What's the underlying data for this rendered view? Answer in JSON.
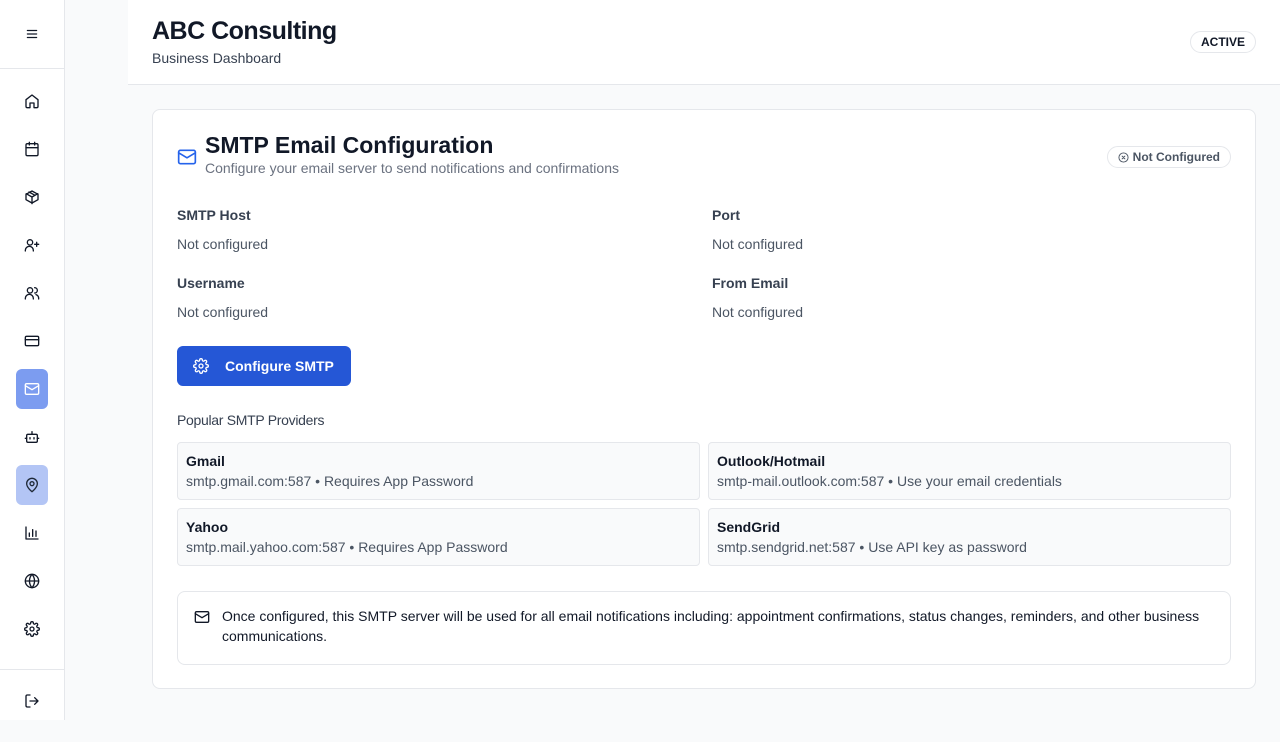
{
  "header": {
    "title": "ABC Consulting",
    "subtitle": "Business Dashboard",
    "status_badge": "ACTIVE"
  },
  "sidebar": {
    "items": [
      {
        "icon": "home-icon"
      },
      {
        "icon": "calendar-icon"
      },
      {
        "icon": "package-icon"
      },
      {
        "icon": "user-plus-icon"
      },
      {
        "icon": "users-icon"
      },
      {
        "icon": "credit-card-icon"
      },
      {
        "icon": "mail-icon",
        "active": true
      },
      {
        "icon": "bot-icon"
      },
      {
        "icon": "map-pin-icon",
        "highlighted": true
      },
      {
        "icon": "bar-chart-icon"
      },
      {
        "icon": "globe-icon"
      },
      {
        "icon": "settings-icon"
      }
    ],
    "logout_icon": "logout-icon",
    "menu_icon": "menu-icon"
  },
  "smtp": {
    "title": "SMTP Email Configuration",
    "subtitle": "Configure your email server to send notifications and confirmations",
    "status": "Not Configured",
    "fields": {
      "host_label": "SMTP Host",
      "host_value": "Not configured",
      "port_label": "Port",
      "port_value": "Not configured",
      "username_label": "Username",
      "username_value": "Not configured",
      "from_label": "From Email",
      "from_value": "Not configured"
    },
    "configure_button": "Configure SMTP",
    "providers_heading": "Popular SMTP Providers",
    "providers": [
      {
        "name": "Gmail",
        "detail": "smtp.gmail.com:587 • Requires App Password"
      },
      {
        "name": "Outlook/Hotmail",
        "detail": "smtp-mail.outlook.com:587 • Use your email credentials"
      },
      {
        "name": "Yahoo",
        "detail": "smtp.mail.yahoo.com:587 • Requires App Password"
      },
      {
        "name": "SendGrid",
        "detail": "smtp.sendgrid.net:587 • Use API key as password"
      }
    ],
    "notice": "Once configured, this SMTP server will be used for all email notifications including: appointment confirmations, status changes, reminders, and other business communications."
  },
  "colors": {
    "primary": "#2557d6",
    "accent_icon": "#2563eb",
    "sidebar_active": "#7c9cf0",
    "sidebar_highlight": "#b3c5f5"
  }
}
